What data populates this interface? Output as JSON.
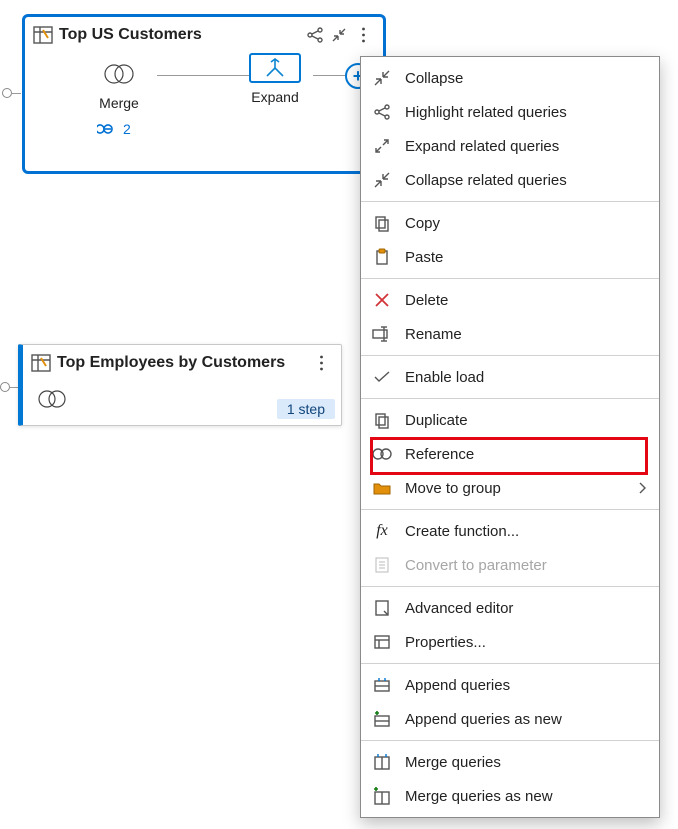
{
  "cards": {
    "top": {
      "title": "Top US Customers",
      "merge_label": "Merge",
      "expand_label": "Expand",
      "link_count": "2"
    },
    "emp": {
      "title": "Top Employees by Customers",
      "step_label": "1 step"
    }
  },
  "menu": {
    "collapse": "Collapse",
    "highlight_related": "Highlight related queries",
    "expand_related": "Expand related queries",
    "collapse_related": "Collapse related queries",
    "copy": "Copy",
    "paste": "Paste",
    "delete": "Delete",
    "rename": "Rename",
    "enable_load": "Enable load",
    "duplicate": "Duplicate",
    "reference": "Reference",
    "move_to_group": "Move to group",
    "create_function": "Create function...",
    "convert_to_parameter": "Convert to parameter",
    "advanced_editor": "Advanced editor",
    "properties": "Properties...",
    "append_queries": "Append queries",
    "append_queries_new": "Append queries as new",
    "merge_queries": "Merge queries",
    "merge_queries_new": "Merge queries as new"
  }
}
